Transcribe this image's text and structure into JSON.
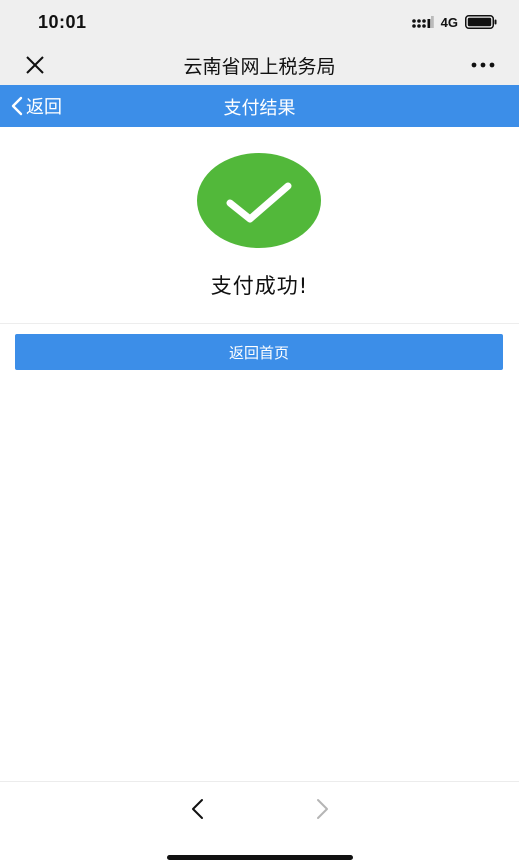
{
  "status_bar": {
    "time": "10:01",
    "network": "4G",
    "icons": [
      "signal-icon",
      "battery-icon"
    ]
  },
  "title_bar": {
    "title": "云南省网上税务局",
    "icons": [
      "close-icon",
      "more-icon"
    ]
  },
  "nav_bar": {
    "back_label": "返回",
    "title": "支付结果",
    "icons": [
      "back-chevron-icon"
    ]
  },
  "result": {
    "status_icon": "success-check-icon",
    "message": "支付成功!",
    "accent_color": "#52b83a"
  },
  "actions": {
    "home_button_label": "返回首页",
    "button_color": "#3c8ee8"
  },
  "browser_toolbar": {
    "icons": [
      "nav-back-icon",
      "nav-forward-icon"
    ]
  }
}
